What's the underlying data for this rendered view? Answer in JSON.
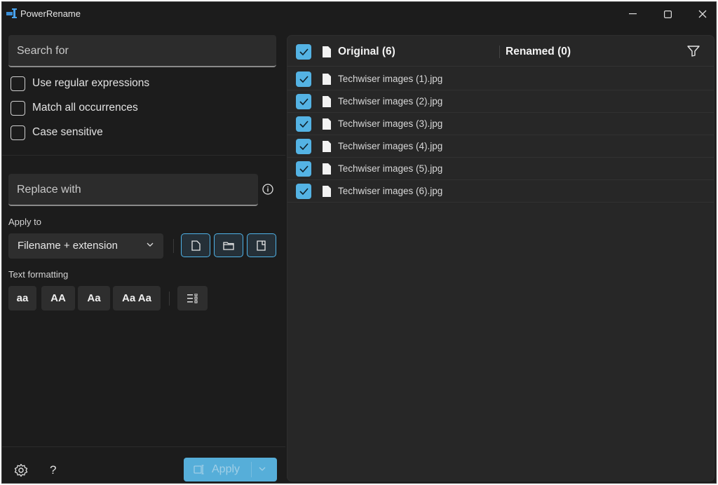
{
  "window": {
    "title": "PowerRename"
  },
  "search": {
    "placeholder": "Search for"
  },
  "options": [
    {
      "label": "Use regular expressions"
    },
    {
      "label": "Match all occurrences"
    },
    {
      "label": "Case sensitive"
    }
  ],
  "replace": {
    "placeholder": "Replace with"
  },
  "apply_to": {
    "label": "Apply to",
    "selected": "Filename + extension"
  },
  "text_formatting": {
    "label": "Text formatting",
    "buttons": [
      "aa",
      "AA",
      "Aa",
      "Aa Aa"
    ]
  },
  "footer": {
    "help": "?",
    "apply_label": "Apply"
  },
  "list": {
    "original_header": "Original (6)",
    "renamed_header": "Renamed (0)",
    "files": [
      "Techwiser images (1).jpg",
      "Techwiser images (2).jpg",
      "Techwiser images (3).jpg",
      "Techwiser images (4).jpg",
      "Techwiser images (5).jpg",
      "Techwiser images (6).jpg"
    ]
  },
  "colors": {
    "accent": "#54b3e4",
    "background": "#1c1c1c",
    "panel": "#272727"
  }
}
